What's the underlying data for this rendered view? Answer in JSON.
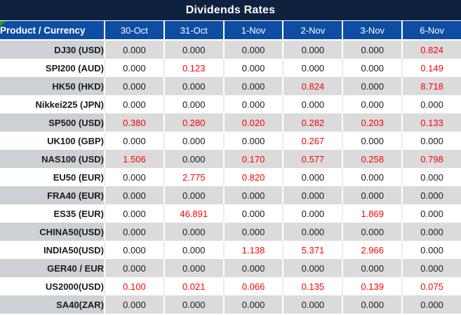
{
  "title": "Dividends Rates",
  "columns": {
    "product_header": "Product / Currency",
    "dates": [
      "30-Oct",
      "31-Oct",
      "1-Nov",
      "2-Nov",
      "3-Nov",
      "6-Nov"
    ]
  },
  "rows": [
    {
      "product": "DJ30 (USD)",
      "values": [
        "0.000",
        "0.000",
        "0.000",
        "0.000",
        "0.000",
        "0.824"
      ]
    },
    {
      "product": "SPI200 (AUD)",
      "values": [
        "0.000",
        "0.123",
        "0.000",
        "0.000",
        "0.000",
        "0.149"
      ]
    },
    {
      "product": "HK50 (HKD)",
      "values": [
        "0.000",
        "0.000",
        "0.000",
        "0.824",
        "0.000",
        "8.718"
      ]
    },
    {
      "product": "Nikkei225 (JPN)",
      "values": [
        "0.000",
        "0.000",
        "0.000",
        "0.000",
        "0.000",
        "0.000"
      ]
    },
    {
      "product": "SP500 (USD)",
      "values": [
        "0.380",
        "0.280",
        "0.020",
        "0.282",
        "0.203",
        "0.133"
      ]
    },
    {
      "product": "UK100 (GBP)",
      "values": [
        "0.000",
        "0.000",
        "0.000",
        "0.267",
        "0.000",
        "0.000"
      ]
    },
    {
      "product": "NAS100 (USD)",
      "values": [
        "1.506",
        "0.000",
        "0.170",
        "0.577",
        "0.258",
        "0.798"
      ]
    },
    {
      "product": "EU50 (EUR)",
      "values": [
        "0.000",
        "2.775",
        "0.820",
        "0.000",
        "0.000",
        "0.000"
      ]
    },
    {
      "product": "FRA40 (EUR)",
      "values": [
        "0.000",
        "0.000",
        "0.000",
        "0.000",
        "0.000",
        "0.000"
      ]
    },
    {
      "product": "ES35 (EUR)",
      "values": [
        "0.000",
        "46.891",
        "0.000",
        "0.000",
        "1.869",
        "0.000"
      ]
    },
    {
      "product": "CHINA50(USD)",
      "values": [
        "0.000",
        "0.000",
        "0.000",
        "0.000",
        "0.000",
        "0.000"
      ]
    },
    {
      "product": "INDIA50(USD)",
      "values": [
        "0.000",
        "0.000",
        "1.138",
        "5.371",
        "2.966",
        "0.000"
      ]
    },
    {
      "product": "GER40 / EUR",
      "values": [
        "0.000",
        "0.000",
        "0.000",
        "0.000",
        "0.000",
        "0.000"
      ]
    },
    {
      "product": "US2000(USD)",
      "values": [
        "0.100",
        "0.021",
        "0.066",
        "0.135",
        "0.139",
        "0.075"
      ]
    },
    {
      "product": "SA40(ZAR)",
      "values": [
        "0.000",
        "0.000",
        "0.000",
        "0.000",
        "0.000",
        "0.000"
      ]
    }
  ],
  "icons": {
    "corner_marker": "green-triangle"
  },
  "colors": {
    "title_bg": "#0E2240",
    "header_bg": "#0D4EA2",
    "row_gray_product": "#CDD1D6",
    "row_gray_values": "#DBDBDB",
    "row_white": "#FFFFFF",
    "value_zero": "#1A1A1A",
    "value_nonzero": "#FF0000",
    "corner_marker": "#21A121"
  }
}
